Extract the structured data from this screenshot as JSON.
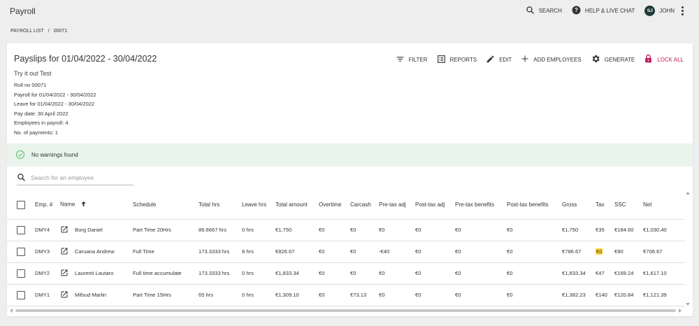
{
  "header": {
    "app_title": "Payroll",
    "search_label": "SEARCH",
    "help_label": "HELP & LIVE CHAT",
    "avatar_initials": "SJ",
    "user_name": "JOHN"
  },
  "breadcrumb": {
    "list_label": "PAYROLL LIST",
    "separator": "/",
    "current": "00071"
  },
  "card": {
    "title": "Payslips for 01/04/2022 - 30/04/2022",
    "subtitle": "Try it out Test",
    "details": [
      "Roll no 00071",
      "Payroll for 01/04/2022 - 30/04/2022",
      "Leave for 01/04/2022 - 30/04/2022",
      "Pay date: 30 April 2022",
      "Employees in payroll: 4",
      "No. of payments: 1"
    ]
  },
  "toolbar": {
    "filter": "FILTER",
    "reports": "REPORTS",
    "edit": "EDIT",
    "add_employees": "ADD EMPLOYEES",
    "generate": "GENERATE",
    "lock_all": "LOCK ALL"
  },
  "alert": {
    "text": "No warnings found"
  },
  "search": {
    "placeholder": "Search for an employee"
  },
  "table": {
    "columns": {
      "emp": "Emp. #",
      "name": "Name",
      "schedule": "Schedule",
      "total_hrs": "Total hrs",
      "leave_hrs": "Leave hrs",
      "total_amount": "Total amount",
      "overtime": "Overtime",
      "carcash": "Carcash",
      "pretax_adj": "Pre-tax adj",
      "posttax_adj": "Post-tax adj",
      "pretax_benefits": "Pre-tax benefits",
      "posttax_benefits": "Post-tax benefits",
      "gross": "Gross",
      "tax": "Tax",
      "ssc": "SSC",
      "net": "Net"
    },
    "rows": [
      {
        "emp": "DMY4",
        "name": "Borg Daniel",
        "schedule": "Part Time 20Hrs",
        "total_hrs": "86.6667 hrs",
        "leave_hrs": "0 hrs",
        "total_amount": "€1,750",
        "overtime": "€0",
        "carcash": "€0",
        "pretax_adj": "€0",
        "posttax_adj": "€0",
        "pretax_benefits": "€0",
        "posttax_benefits": "€0",
        "gross": "€1,750",
        "tax": "€35",
        "ssc": "€184.60",
        "net": "€1,030.40"
      },
      {
        "emp": "DMY3",
        "name": "Caruana Andrew",
        "schedule": "Full Time",
        "total_hrs": "173.3333 hrs",
        "leave_hrs": "8 hrs",
        "total_amount": "€826.67",
        "overtime": "€0",
        "carcash": "€0",
        "pretax_adj": "-€40",
        "posttax_adj": "€0",
        "pretax_benefits": "€0",
        "posttax_benefits": "€0",
        "gross": "€786.67",
        "tax": "€0",
        "ssc": "€80",
        "net": "€706.67"
      },
      {
        "emp": "DMY2",
        "name": "Laurenti Lautaro",
        "schedule": "Full time accumulate",
        "total_hrs": "173.3333 hrs",
        "leave_hrs": "0 hrs",
        "total_amount": "€1,833.34",
        "overtime": "€0",
        "carcash": "€0",
        "pretax_adj": "€0",
        "posttax_adj": "€0",
        "pretax_benefits": "€0",
        "posttax_benefits": "€0",
        "gross": "€1,833.34",
        "tax": "€47",
        "ssc": "€169.24",
        "net": "€1,617.10"
      },
      {
        "emp": "DMY1",
        "name": "Mifsud Marlin",
        "schedule": "Part Time 15Hrs",
        "total_hrs": "65 hrs",
        "leave_hrs": "0 hrs",
        "total_amount": "€1,309.10",
        "overtime": "€0",
        "carcash": "€73.13",
        "pretax_adj": "€0",
        "posttax_adj": "€0",
        "pretax_benefits": "€0",
        "posttax_benefits": "€0",
        "gross": "€1,382.23",
        "tax": "€140",
        "ssc": "€120.84",
        "net": "€1,121.39"
      }
    ]
  },
  "colors": {
    "lock_accent": "#c2185b",
    "alert_bg": "#e8f4ec",
    "highlight": "#ffd740",
    "avatar_bg": "#1f3a3a"
  }
}
